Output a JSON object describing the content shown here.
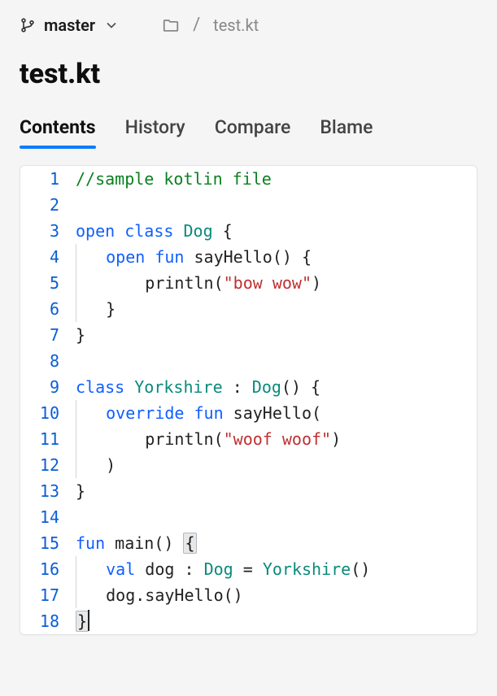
{
  "branch": {
    "name": "master"
  },
  "breadcrumb": {
    "file": "test.kt"
  },
  "title": "test.kt",
  "tabs": [
    {
      "label": "Contents",
      "active": true
    },
    {
      "label": "History",
      "active": false
    },
    {
      "label": "Compare",
      "active": false
    },
    {
      "label": "Blame",
      "active": false
    }
  ],
  "code": {
    "lines": [
      {
        "n": 1,
        "indent": 0,
        "tokens": [
          [
            "cmt",
            "//sample kotlin file"
          ]
        ]
      },
      {
        "n": 2,
        "indent": 0,
        "tokens": []
      },
      {
        "n": 3,
        "indent": 0,
        "tokens": [
          [
            "kw",
            "open"
          ],
          [
            "sp",
            " "
          ],
          [
            "kw",
            "class"
          ],
          [
            "sp",
            " "
          ],
          [
            "cls",
            "Dog"
          ],
          [
            "sp",
            " "
          ],
          [
            "p",
            "{"
          ]
        ]
      },
      {
        "n": 4,
        "indent": 1,
        "tokens": [
          [
            "kw",
            "open"
          ],
          [
            "sp",
            " "
          ],
          [
            "kw",
            "fun"
          ],
          [
            "sp",
            " "
          ],
          [
            "fn",
            "sayHello"
          ],
          [
            "p",
            "()"
          ],
          [
            "sp",
            " "
          ],
          [
            "p",
            "{"
          ]
        ]
      },
      {
        "n": 5,
        "indent": 2,
        "tokens": [
          [
            "fn",
            "println"
          ],
          [
            "p",
            "("
          ],
          [
            "str",
            "\"bow wow\""
          ],
          [
            "p",
            ")"
          ]
        ]
      },
      {
        "n": 6,
        "indent": 1,
        "tokens": [
          [
            "p",
            "}"
          ]
        ]
      },
      {
        "n": 7,
        "indent": 0,
        "tokens": [
          [
            "p",
            "}"
          ]
        ]
      },
      {
        "n": 8,
        "indent": 0,
        "tokens": []
      },
      {
        "n": 9,
        "indent": 0,
        "tokens": [
          [
            "kw",
            "class"
          ],
          [
            "sp",
            " "
          ],
          [
            "cls",
            "Yorkshire"
          ],
          [
            "sp",
            " "
          ],
          [
            "p",
            ":"
          ],
          [
            "sp",
            " "
          ],
          [
            "cls",
            "Dog"
          ],
          [
            "p",
            "()"
          ],
          [
            "sp",
            " "
          ],
          [
            "p",
            "{"
          ]
        ]
      },
      {
        "n": 10,
        "indent": 1,
        "tokens": [
          [
            "kw",
            "override"
          ],
          [
            "sp",
            " "
          ],
          [
            "kw",
            "fun"
          ],
          [
            "sp",
            " "
          ],
          [
            "fn",
            "sayHello"
          ],
          [
            "p",
            "("
          ]
        ]
      },
      {
        "n": 11,
        "indent": 2,
        "tokens": [
          [
            "fn",
            "println"
          ],
          [
            "p",
            "("
          ],
          [
            "str",
            "\"woof woof\""
          ],
          [
            "p",
            ")"
          ]
        ]
      },
      {
        "n": 12,
        "indent": 1,
        "tokens": [
          [
            "p",
            ")"
          ]
        ]
      },
      {
        "n": 13,
        "indent": 0,
        "tokens": [
          [
            "p",
            "}"
          ]
        ]
      },
      {
        "n": 14,
        "indent": 0,
        "tokens": []
      },
      {
        "n": 15,
        "indent": 0,
        "tokens": [
          [
            "kw",
            "fun"
          ],
          [
            "sp",
            " "
          ],
          [
            "fn",
            "main"
          ],
          [
            "p",
            "()"
          ],
          [
            "sp",
            " "
          ],
          [
            "hl",
            "{"
          ]
        ]
      },
      {
        "n": 16,
        "indent": 1,
        "tokens": [
          [
            "kw",
            "val"
          ],
          [
            "sp",
            " "
          ],
          [
            "id",
            "dog"
          ],
          [
            "sp",
            " "
          ],
          [
            "p",
            ":"
          ],
          [
            "sp",
            " "
          ],
          [
            "cls",
            "Dog"
          ],
          [
            "sp",
            " "
          ],
          [
            "p",
            "="
          ],
          [
            "sp",
            " "
          ],
          [
            "cls",
            "Yorkshire"
          ],
          [
            "p",
            "()"
          ]
        ]
      },
      {
        "n": 17,
        "indent": 1,
        "tokens": [
          [
            "id",
            "dog"
          ],
          [
            "p",
            "."
          ],
          [
            "fn",
            "sayHello"
          ],
          [
            "p",
            "()"
          ]
        ]
      },
      {
        "n": 18,
        "indent": 0,
        "tokens": [
          [
            "hl",
            "}"
          ],
          [
            "cursor",
            ""
          ]
        ]
      }
    ]
  }
}
